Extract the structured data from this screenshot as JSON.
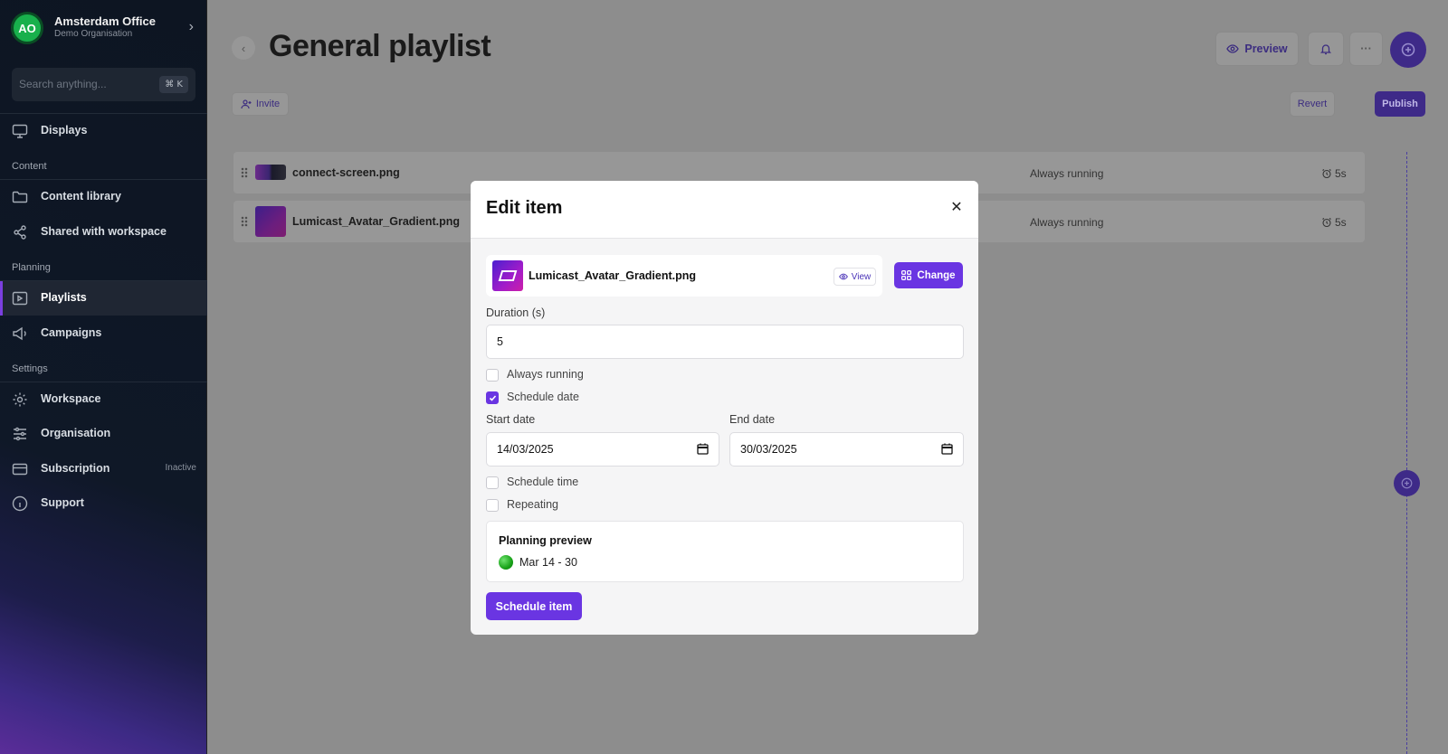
{
  "org": {
    "initials": "AO",
    "name": "Amsterdam Office",
    "subtitle": "Demo Organisation"
  },
  "search": {
    "placeholder": "Search anything...",
    "shortcut": "⌘ K"
  },
  "nav": {
    "displays": "Displays",
    "section_content": "Content",
    "content_library": "Content library",
    "shared": "Shared with workspace",
    "section_planning": "Planning",
    "playlists": "Playlists",
    "campaigns": "Campaigns",
    "section_settings": "Settings",
    "workspace": "Workspace",
    "organisation": "Organisation",
    "subscription": "Subscription",
    "subscription_badge": "Inactive",
    "support": "Support"
  },
  "page": {
    "title": "General playlist",
    "preview_label": "Preview",
    "more_label": "···",
    "invite_label": "Invite",
    "revert_label": "Revert",
    "publish_label": "Publish"
  },
  "playlist_items": [
    {
      "name": "connect-screen.png",
      "status": "Always running",
      "duration": "5s"
    },
    {
      "name": "Lumicast_Avatar_Gradient.png",
      "status": "Always running",
      "duration": "5s"
    }
  ],
  "modal": {
    "title": "Edit item",
    "file_name": "Lumicast_Avatar_Gradient.png",
    "view_label": "View",
    "change_label": "Change",
    "duration_label": "Duration (s)",
    "duration_value": "5",
    "always_running_label": "Always running",
    "schedule_date_label": "Schedule date",
    "start_date_label": "Start date",
    "start_date_value": "14/03/2025",
    "end_date_label": "End date",
    "end_date_value": "30/03/2025",
    "schedule_time_label": "Schedule time",
    "repeating_label": "Repeating",
    "planning_preview_title": "Planning preview",
    "planning_preview_range": "Mar 14 - 30",
    "schedule_button": "Schedule item"
  },
  "checks": {
    "always_running": false,
    "schedule_date": true,
    "schedule_time": false,
    "repeating": false
  },
  "colors": {
    "accent": "#6a35e2",
    "org_avatar": "#18b04c",
    "preview_dot": "#18a218"
  }
}
